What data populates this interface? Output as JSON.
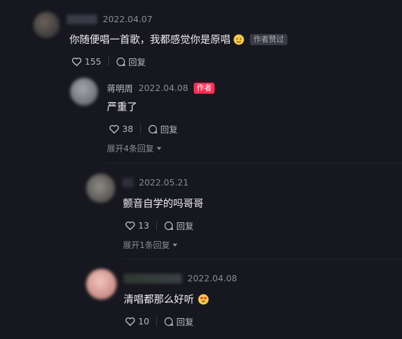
{
  "comments": [
    {
      "date": "2022.04.07",
      "text": "你随便唱一首歌，我都感觉你是原唱",
      "emoji": "sweat-smile-emoji",
      "author_liked_badge": "作者赞过",
      "likes": "155",
      "reply_label": "回复"
    },
    {
      "name": "蒋明周",
      "date": "2022.04.08",
      "author_badge": "作者",
      "text": "严重了",
      "likes": "38",
      "reply_label": "回复",
      "expand_label": "展开4条回复"
    },
    {
      "date": "2022.05.21",
      "text": "颤音自学的吗哥哥",
      "likes": "13",
      "reply_label": "回复",
      "expand_label": "展开1条回复"
    },
    {
      "date": "2022.04.08",
      "text": "清唱都那么好听",
      "emoji": "heart-eyes-emoji",
      "likes": "10",
      "reply_label": "回复"
    }
  ],
  "colors": {
    "background": "#17171f",
    "author_badge": "#fe2c55",
    "muted_text": "#8a8b93"
  }
}
